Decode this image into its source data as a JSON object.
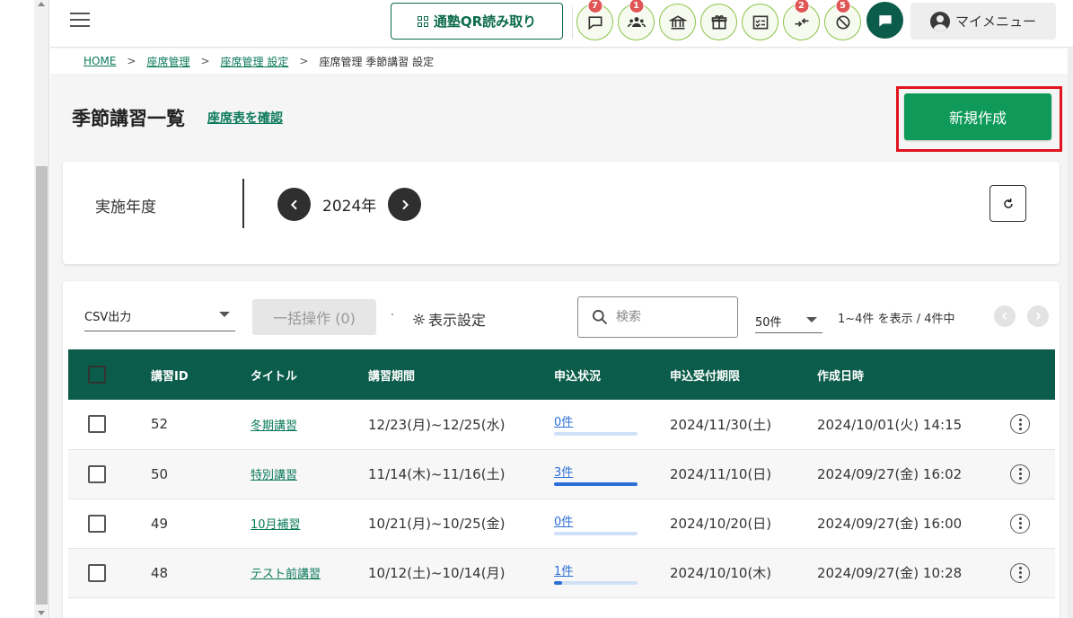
{
  "header": {
    "qr_button_label": "通塾QR読み取り",
    "my_menu_label": "マイメニュー",
    "icon_buttons": [
      {
        "name": "message-icon",
        "badge": "7"
      },
      {
        "name": "students-icon",
        "badge": "1"
      },
      {
        "name": "school-icon",
        "badge": ""
      },
      {
        "name": "gift-icon",
        "badge": ""
      },
      {
        "name": "checklist-icon",
        "badge": ""
      },
      {
        "name": "transfer-icon",
        "badge": "2"
      },
      {
        "name": "no-entry-icon",
        "badge": "5"
      }
    ]
  },
  "breadcrumb": {
    "items": [
      "HOME",
      "座席管理",
      "座席管理 設定"
    ],
    "current": "座席管理 季節講習 設定",
    "separator": ">"
  },
  "page": {
    "title": "季節講習一覧",
    "seat_link": "座席表を確認",
    "new_button": "新規作成"
  },
  "year_filter": {
    "label": "実施年度",
    "value": "2024年"
  },
  "toolbar": {
    "csv_label": "CSV出力",
    "bulk_label": "一括操作 (0)",
    "display_setting": "表示設定",
    "search_placeholder": "検索",
    "per_page": "50件",
    "count_text": "1~4件 を表示 / 4件中"
  },
  "table": {
    "columns": [
      "講習ID",
      "タイトル",
      "講習期間",
      "申込状況",
      "申込受付期限",
      "作成日時"
    ],
    "rows": [
      {
        "id": "52",
        "title": "冬期講習",
        "period": "12/23(月)~12/25(水)",
        "status": "0件",
        "progress": 0,
        "deadline": "2024/11/30(土)",
        "created": "2024/10/01(火) 14:15"
      },
      {
        "id": "50",
        "title": "特別講習",
        "period": "11/14(木)~11/16(土)",
        "status": "3件",
        "progress": 1.0,
        "deadline": "2024/11/10(日)",
        "created": "2024/09/27(金) 16:02"
      },
      {
        "id": "49",
        "title": "10月補習",
        "period": "10/21(月)~10/25(金)",
        "status": "0件",
        "progress": 0,
        "deadline": "2024/10/20(日)",
        "created": "2024/09/27(金) 16:00"
      },
      {
        "id": "48",
        "title": "テスト前講習",
        "period": "10/12(土)~10/14(月)",
        "status": "1件",
        "progress": 0.1,
        "deadline": "2024/10/10(木)",
        "created": "2024/09/27(金) 10:28"
      }
    ]
  },
  "colors": {
    "brand_green": "#0b5c4a",
    "button_green": "#0f9a5a",
    "link_green": "#0b7a5a",
    "highlight_red": "#e0141e",
    "badge_red": "#e05555"
  }
}
